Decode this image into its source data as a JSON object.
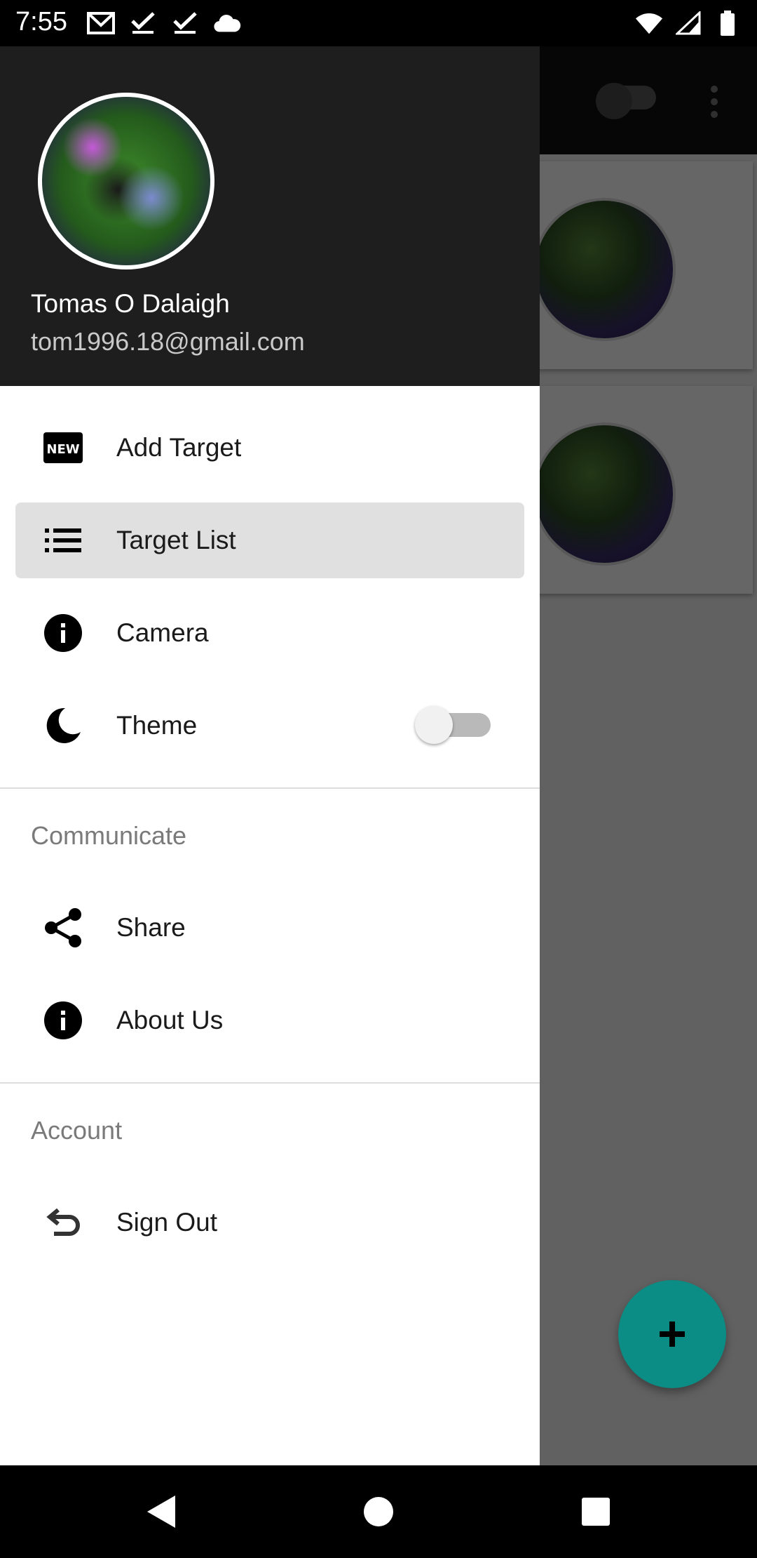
{
  "status_bar": {
    "time": "7:55",
    "left_icons": [
      "gmail-icon",
      "check-icon",
      "check-icon",
      "cloud-icon"
    ],
    "right_icons": [
      "wifi-icon",
      "signal-icon",
      "battery-icon"
    ]
  },
  "drawer": {
    "header": {
      "name": "Tomas O Dalaigh",
      "email": "tom1996.18@gmail.com"
    },
    "items": [
      {
        "label": "Add Target",
        "icon": "new-badge-icon",
        "selected": false
      },
      {
        "label": "Target List",
        "icon": "list-icon",
        "selected": true
      },
      {
        "label": "Camera",
        "icon": "info-icon",
        "selected": false
      },
      {
        "label": "Theme",
        "icon": "moon-icon",
        "selected": false,
        "toggle": false
      }
    ],
    "communicate": {
      "title": "Communicate",
      "items": [
        {
          "label": "Share",
          "icon": "share-icon"
        },
        {
          "label": "About Us",
          "icon": "info-icon"
        }
      ]
    },
    "account": {
      "title": "Account",
      "items": [
        {
          "label": "Sign Out",
          "icon": "undo-icon"
        }
      ]
    }
  },
  "colors": {
    "header_bg": "#1e1e1e",
    "selected_bg": "#e0e0e0",
    "fab": "#0b8c84"
  }
}
